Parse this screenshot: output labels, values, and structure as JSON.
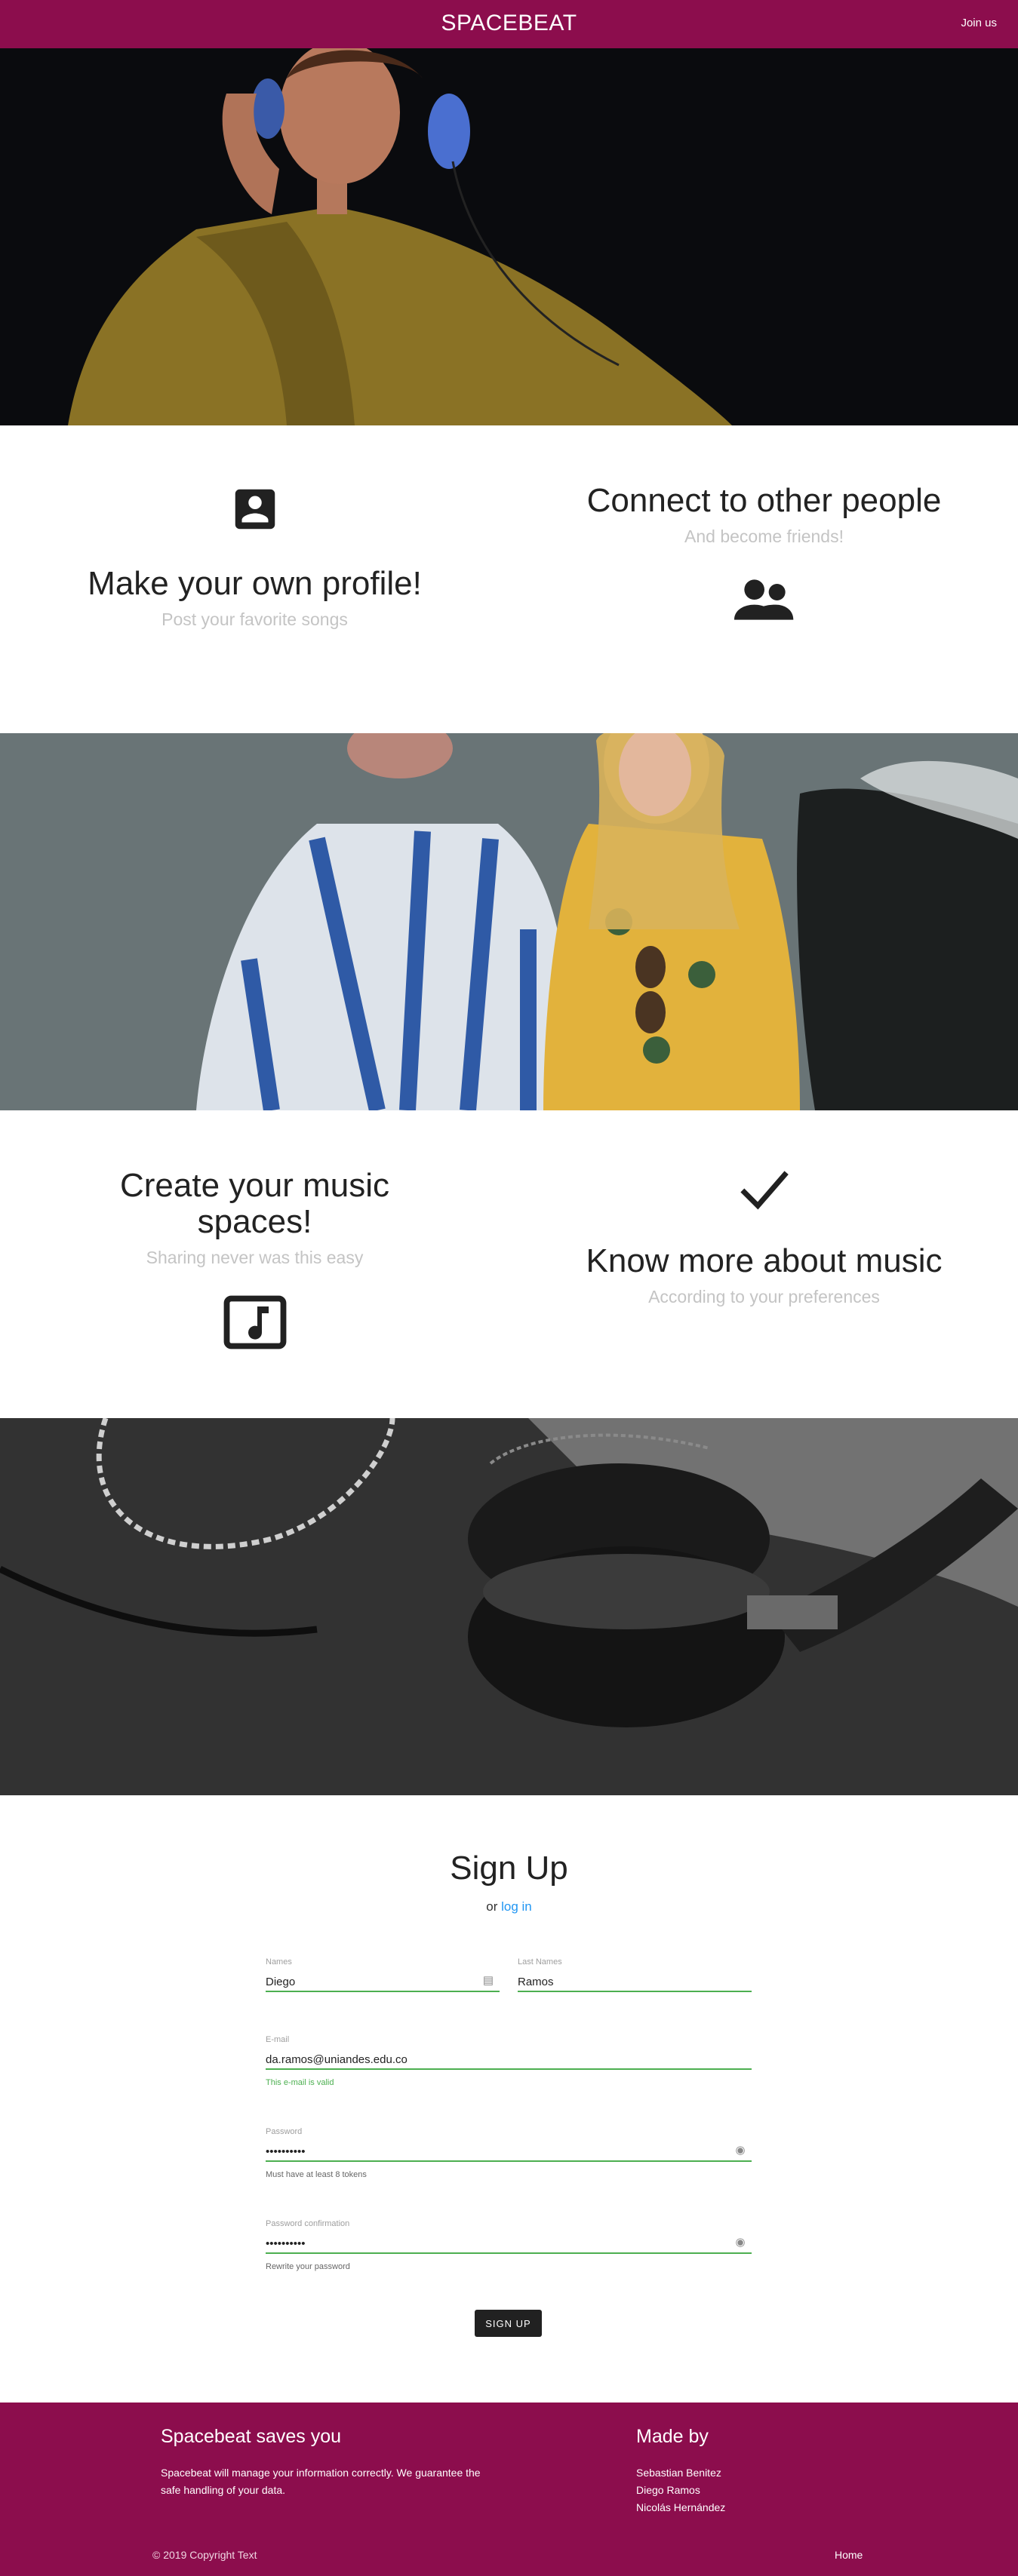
{
  "navbar": {
    "brand": "SPACEBEAT",
    "join": "Join us"
  },
  "features": {
    "profile": {
      "icon": "account-box-icon",
      "title": "Make your own profile!",
      "subtitle": "Post your favorite songs"
    },
    "connect": {
      "icon": "people-icon",
      "title": "Connect to other people",
      "subtitle": "And become friends!"
    },
    "spaces": {
      "icon": "music-note-box-icon",
      "title": "Create your music spaces!",
      "subtitle": "Sharing never was this easy"
    },
    "know": {
      "icon": "check-icon",
      "title": "Know more about music",
      "subtitle": "According to your preferences"
    }
  },
  "signup": {
    "title": "Sign Up",
    "or": "or",
    "login": "log in",
    "names": {
      "label": "Names",
      "value": "Diego"
    },
    "lastnames": {
      "label": "Last Names",
      "value": "Ramos"
    },
    "email": {
      "label": "E-mail",
      "value": "da.ramos@uniandes.edu.co",
      "helper": "This e-mail is valid"
    },
    "password": {
      "label": "Password",
      "value": "••••••••••",
      "helper": "Must have at least 8 tokens"
    },
    "confirm": {
      "label": "Password confirmation",
      "value": "••••••••••",
      "helper": "Rewrite your password"
    },
    "button": "SIGN UP"
  },
  "footer": {
    "about_title": "Spacebeat saves you",
    "about_text": "Spacebeat will manage your information correctly. We guarantee the safe handling of your data.",
    "made_title": "Made by",
    "authors": [
      "Sebastian Benitez",
      "Diego Ramos",
      "Nicolás Hernández"
    ],
    "copyright": "© 2019 Copyright Text",
    "home": "Home"
  },
  "colors": {
    "brand": "#8c0d4d",
    "valid": "#4caf50",
    "link": "#2196f3"
  }
}
